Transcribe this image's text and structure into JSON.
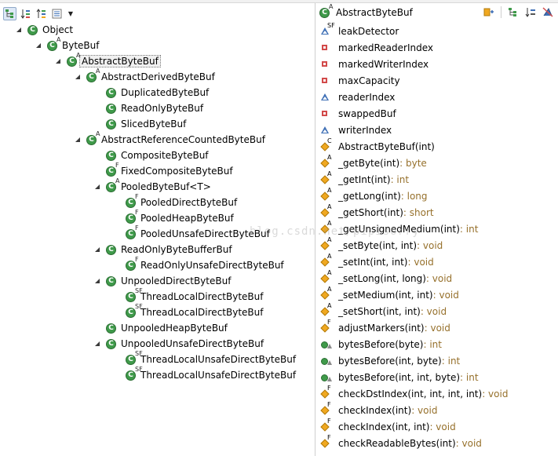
{
  "left_toolbar": {
    "buttons": [
      "show-hierarchy-icon",
      "sort-icon",
      "sort-by-defining-type-icon",
      "show-members-icon"
    ],
    "dropdown": "▼"
  },
  "tree": [
    {
      "label": "Object",
      "depth": 0,
      "expanded": true,
      "overlay": ""
    },
    {
      "label": "ByteBuf",
      "depth": 1,
      "expanded": true,
      "overlay": "A"
    },
    {
      "label": "AbstractByteBuf",
      "depth": 2,
      "expanded": true,
      "overlay": "A",
      "selected": true
    },
    {
      "label": "AbstractDerivedByteBuf",
      "depth": 3,
      "expanded": true,
      "overlay": "A"
    },
    {
      "label": "DuplicatedByteBuf",
      "depth": 4,
      "expanded": null,
      "overlay": ""
    },
    {
      "label": "ReadOnlyByteBuf",
      "depth": 4,
      "expanded": null,
      "overlay": ""
    },
    {
      "label": "SlicedByteBuf",
      "depth": 4,
      "expanded": null,
      "overlay": ""
    },
    {
      "label": "AbstractReferenceCountedByteBuf",
      "depth": 3,
      "expanded": true,
      "overlay": "A"
    },
    {
      "label": "CompositeByteBuf",
      "depth": 4,
      "expanded": null,
      "overlay": ""
    },
    {
      "label": "FixedCompositeByteBuf",
      "depth": 4,
      "expanded": null,
      "overlay": "F"
    },
    {
      "label": "PooledByteBuf<T>",
      "depth": 4,
      "expanded": true,
      "overlay": "A"
    },
    {
      "label": "PooledDirectByteBuf",
      "depth": 5,
      "expanded": null,
      "overlay": "F"
    },
    {
      "label": "PooledHeapByteBuf",
      "depth": 5,
      "expanded": null,
      "overlay": "F"
    },
    {
      "label": "PooledUnsafeDirectByteBuf",
      "depth": 5,
      "expanded": null,
      "overlay": "F"
    },
    {
      "label": "ReadOnlyByteBufferBuf",
      "depth": 4,
      "expanded": true,
      "overlay": ""
    },
    {
      "label": "ReadOnlyUnsafeDirectByteBuf",
      "depth": 5,
      "expanded": null,
      "overlay": "F"
    },
    {
      "label": "UnpooledDirectByteBuf",
      "depth": 4,
      "expanded": true,
      "overlay": ""
    },
    {
      "label": "ThreadLocalDirectByteBuf",
      "depth": 5,
      "expanded": null,
      "overlay": "SF"
    },
    {
      "label": "ThreadLocalDirectByteBuf",
      "depth": 5,
      "expanded": null,
      "overlay": "SF"
    },
    {
      "label": "UnpooledHeapByteBuf",
      "depth": 4,
      "expanded": null,
      "overlay": ""
    },
    {
      "label": "UnpooledUnsafeDirectByteBuf",
      "depth": 4,
      "expanded": true,
      "overlay": ""
    },
    {
      "label": "ThreadLocalUnsafeDirectByteBuf",
      "depth": 5,
      "expanded": null,
      "overlay": "SF"
    },
    {
      "label": "ThreadLocalUnsafeDirectByteBuf",
      "depth": 5,
      "expanded": null,
      "overlay": "SF"
    }
  ],
  "members_header": {
    "class_name": "AbstractByteBuf",
    "class_overlay": "A",
    "tools": [
      "lock-view-icon",
      "show-inherited-members-icon",
      "sort-by-defining-type-icon",
      "hide-fields-icon"
    ]
  },
  "members": [
    {
      "name": "leakDetector",
      "type": "",
      "kind": "static-final-field",
      "overlay": "SF"
    },
    {
      "name": "markedReaderIndex",
      "type": "",
      "kind": "private-field",
      "overlay": ""
    },
    {
      "name": "markedWriterIndex",
      "type": "",
      "kind": "private-field",
      "overlay": ""
    },
    {
      "name": "maxCapacity",
      "type": "",
      "kind": "private-field",
      "overlay": ""
    },
    {
      "name": "readerIndex",
      "type": "",
      "kind": "package-field",
      "overlay": ""
    },
    {
      "name": "swappedBuf",
      "type": "",
      "kind": "private-field",
      "overlay": ""
    },
    {
      "name": "writerIndex",
      "type": "",
      "kind": "package-field",
      "overlay": ""
    },
    {
      "name": "AbstractByteBuf(int)",
      "type": "",
      "kind": "protected-method",
      "overlay": "C"
    },
    {
      "name": "_getByte(int)",
      "type": " : byte",
      "kind": "protected-method",
      "overlay": "A"
    },
    {
      "name": "_getInt(int)",
      "type": " : int",
      "kind": "protected-method",
      "overlay": "A"
    },
    {
      "name": "_getLong(int)",
      "type": " : long",
      "kind": "protected-method",
      "overlay": "A"
    },
    {
      "name": "_getShort(int)",
      "type": " : short",
      "kind": "protected-method",
      "overlay": "A"
    },
    {
      "name": "_getUnsignedMedium(int)",
      "type": " : int",
      "kind": "protected-method",
      "overlay": "A"
    },
    {
      "name": "_setByte(int, int)",
      "type": " : void",
      "kind": "protected-method",
      "overlay": "A"
    },
    {
      "name": "_setInt(int, int)",
      "type": " : void",
      "kind": "protected-method",
      "overlay": "A"
    },
    {
      "name": "_setLong(int, long)",
      "type": " : void",
      "kind": "protected-method",
      "overlay": "A"
    },
    {
      "name": "_setMedium(int, int)",
      "type": " : void",
      "kind": "protected-method",
      "overlay": "A"
    },
    {
      "name": "_setShort(int, int)",
      "type": " : void",
      "kind": "protected-method",
      "overlay": "A"
    },
    {
      "name": "adjustMarkers(int)",
      "type": " : void",
      "kind": "protected-method",
      "overlay": "F"
    },
    {
      "name": "bytesBefore(byte)",
      "type": " : int",
      "kind": "public-method-overrides",
      "overlay": ""
    },
    {
      "name": "bytesBefore(int, byte)",
      "type": " : int",
      "kind": "public-method-overrides",
      "overlay": ""
    },
    {
      "name": "bytesBefore(int, int, byte)",
      "type": " : int",
      "kind": "public-method-overrides",
      "overlay": ""
    },
    {
      "name": "checkDstIndex(int, int, int, int)",
      "type": " : void",
      "kind": "protected-method",
      "overlay": "F"
    },
    {
      "name": "checkIndex(int)",
      "type": " : void",
      "kind": "protected-method",
      "overlay": "F"
    },
    {
      "name": "checkIndex(int, int)",
      "type": " : void",
      "kind": "protected-method",
      "overlay": "F"
    },
    {
      "name": "checkReadableBytes(int)",
      "type": " : void",
      "kind": "protected-method",
      "overlay": "F"
    }
  ],
  "colors": {
    "class_green": "#3f9a4a",
    "field_red": "#d24a4a",
    "field_blue": "#3e6fb5",
    "method_orange": "#f0a820",
    "type_brown": "#96702b"
  },
  "watermark": "blog.csdn.net/pipisorry"
}
